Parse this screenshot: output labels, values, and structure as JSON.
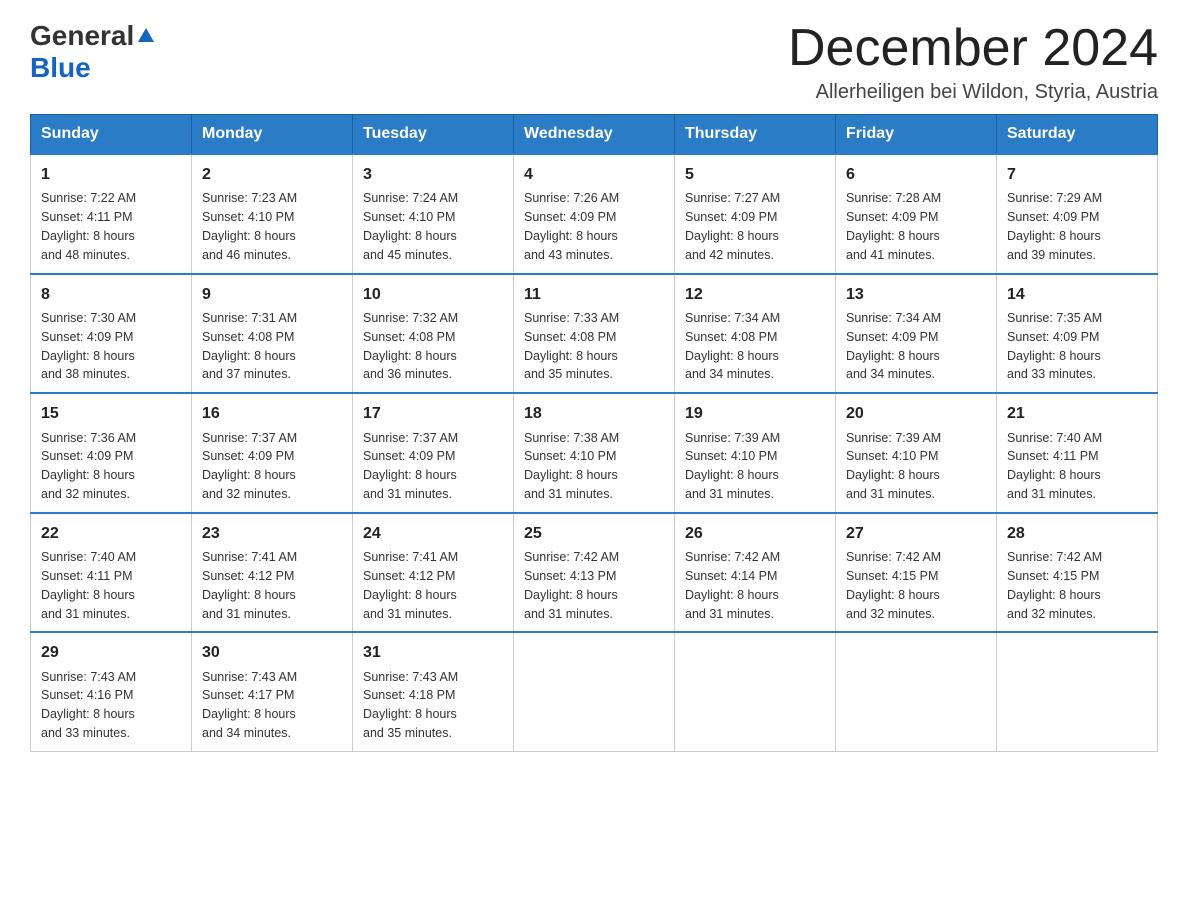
{
  "header": {
    "logo": {
      "general": "General",
      "blue": "Blue",
      "tagline": "GeneralBlue"
    },
    "title": "December 2024",
    "location": "Allerheiligen bei Wildon, Styria, Austria"
  },
  "columns": [
    "Sunday",
    "Monday",
    "Tuesday",
    "Wednesday",
    "Thursday",
    "Friday",
    "Saturday"
  ],
  "weeks": [
    [
      {
        "day": "1",
        "sunrise": "Sunrise: 7:22 AM",
        "sunset": "Sunset: 4:11 PM",
        "daylight": "Daylight: 8 hours",
        "minutes": "and 48 minutes."
      },
      {
        "day": "2",
        "sunrise": "Sunrise: 7:23 AM",
        "sunset": "Sunset: 4:10 PM",
        "daylight": "Daylight: 8 hours",
        "minutes": "and 46 minutes."
      },
      {
        "day": "3",
        "sunrise": "Sunrise: 7:24 AM",
        "sunset": "Sunset: 4:10 PM",
        "daylight": "Daylight: 8 hours",
        "minutes": "and 45 minutes."
      },
      {
        "day": "4",
        "sunrise": "Sunrise: 7:26 AM",
        "sunset": "Sunset: 4:09 PM",
        "daylight": "Daylight: 8 hours",
        "minutes": "and 43 minutes."
      },
      {
        "day": "5",
        "sunrise": "Sunrise: 7:27 AM",
        "sunset": "Sunset: 4:09 PM",
        "daylight": "Daylight: 8 hours",
        "minutes": "and 42 minutes."
      },
      {
        "day": "6",
        "sunrise": "Sunrise: 7:28 AM",
        "sunset": "Sunset: 4:09 PM",
        "daylight": "Daylight: 8 hours",
        "minutes": "and 41 minutes."
      },
      {
        "day": "7",
        "sunrise": "Sunrise: 7:29 AM",
        "sunset": "Sunset: 4:09 PM",
        "daylight": "Daylight: 8 hours",
        "minutes": "and 39 minutes."
      }
    ],
    [
      {
        "day": "8",
        "sunrise": "Sunrise: 7:30 AM",
        "sunset": "Sunset: 4:09 PM",
        "daylight": "Daylight: 8 hours",
        "minutes": "and 38 minutes."
      },
      {
        "day": "9",
        "sunrise": "Sunrise: 7:31 AM",
        "sunset": "Sunset: 4:08 PM",
        "daylight": "Daylight: 8 hours",
        "minutes": "and 37 minutes."
      },
      {
        "day": "10",
        "sunrise": "Sunrise: 7:32 AM",
        "sunset": "Sunset: 4:08 PM",
        "daylight": "Daylight: 8 hours",
        "minutes": "and 36 minutes."
      },
      {
        "day": "11",
        "sunrise": "Sunrise: 7:33 AM",
        "sunset": "Sunset: 4:08 PM",
        "daylight": "Daylight: 8 hours",
        "minutes": "and 35 minutes."
      },
      {
        "day": "12",
        "sunrise": "Sunrise: 7:34 AM",
        "sunset": "Sunset: 4:08 PM",
        "daylight": "Daylight: 8 hours",
        "minutes": "and 34 minutes."
      },
      {
        "day": "13",
        "sunrise": "Sunrise: 7:34 AM",
        "sunset": "Sunset: 4:09 PM",
        "daylight": "Daylight: 8 hours",
        "minutes": "and 34 minutes."
      },
      {
        "day": "14",
        "sunrise": "Sunrise: 7:35 AM",
        "sunset": "Sunset: 4:09 PM",
        "daylight": "Daylight: 8 hours",
        "minutes": "and 33 minutes."
      }
    ],
    [
      {
        "day": "15",
        "sunrise": "Sunrise: 7:36 AM",
        "sunset": "Sunset: 4:09 PM",
        "daylight": "Daylight: 8 hours",
        "minutes": "and 32 minutes."
      },
      {
        "day": "16",
        "sunrise": "Sunrise: 7:37 AM",
        "sunset": "Sunset: 4:09 PM",
        "daylight": "Daylight: 8 hours",
        "minutes": "and 32 minutes."
      },
      {
        "day": "17",
        "sunrise": "Sunrise: 7:37 AM",
        "sunset": "Sunset: 4:09 PM",
        "daylight": "Daylight: 8 hours",
        "minutes": "and 31 minutes."
      },
      {
        "day": "18",
        "sunrise": "Sunrise: 7:38 AM",
        "sunset": "Sunset: 4:10 PM",
        "daylight": "Daylight: 8 hours",
        "minutes": "and 31 minutes."
      },
      {
        "day": "19",
        "sunrise": "Sunrise: 7:39 AM",
        "sunset": "Sunset: 4:10 PM",
        "daylight": "Daylight: 8 hours",
        "minutes": "and 31 minutes."
      },
      {
        "day": "20",
        "sunrise": "Sunrise: 7:39 AM",
        "sunset": "Sunset: 4:10 PM",
        "daylight": "Daylight: 8 hours",
        "minutes": "and 31 minutes."
      },
      {
        "day": "21",
        "sunrise": "Sunrise: 7:40 AM",
        "sunset": "Sunset: 4:11 PM",
        "daylight": "Daylight: 8 hours",
        "minutes": "and 31 minutes."
      }
    ],
    [
      {
        "day": "22",
        "sunrise": "Sunrise: 7:40 AM",
        "sunset": "Sunset: 4:11 PM",
        "daylight": "Daylight: 8 hours",
        "minutes": "and 31 minutes."
      },
      {
        "day": "23",
        "sunrise": "Sunrise: 7:41 AM",
        "sunset": "Sunset: 4:12 PM",
        "daylight": "Daylight: 8 hours",
        "minutes": "and 31 minutes."
      },
      {
        "day": "24",
        "sunrise": "Sunrise: 7:41 AM",
        "sunset": "Sunset: 4:12 PM",
        "daylight": "Daylight: 8 hours",
        "minutes": "and 31 minutes."
      },
      {
        "day": "25",
        "sunrise": "Sunrise: 7:42 AM",
        "sunset": "Sunset: 4:13 PM",
        "daylight": "Daylight: 8 hours",
        "minutes": "and 31 minutes."
      },
      {
        "day": "26",
        "sunrise": "Sunrise: 7:42 AM",
        "sunset": "Sunset: 4:14 PM",
        "daylight": "Daylight: 8 hours",
        "minutes": "and 31 minutes."
      },
      {
        "day": "27",
        "sunrise": "Sunrise: 7:42 AM",
        "sunset": "Sunset: 4:15 PM",
        "daylight": "Daylight: 8 hours",
        "minutes": "and 32 minutes."
      },
      {
        "day": "28",
        "sunrise": "Sunrise: 7:42 AM",
        "sunset": "Sunset: 4:15 PM",
        "daylight": "Daylight: 8 hours",
        "minutes": "and 32 minutes."
      }
    ],
    [
      {
        "day": "29",
        "sunrise": "Sunrise: 7:43 AM",
        "sunset": "Sunset: 4:16 PM",
        "daylight": "Daylight: 8 hours",
        "minutes": "and 33 minutes."
      },
      {
        "day": "30",
        "sunrise": "Sunrise: 7:43 AM",
        "sunset": "Sunset: 4:17 PM",
        "daylight": "Daylight: 8 hours",
        "minutes": "and 34 minutes."
      },
      {
        "day": "31",
        "sunrise": "Sunrise: 7:43 AM",
        "sunset": "Sunset: 4:18 PM",
        "daylight": "Daylight: 8 hours",
        "minutes": "and 35 minutes."
      },
      null,
      null,
      null,
      null
    ]
  ]
}
